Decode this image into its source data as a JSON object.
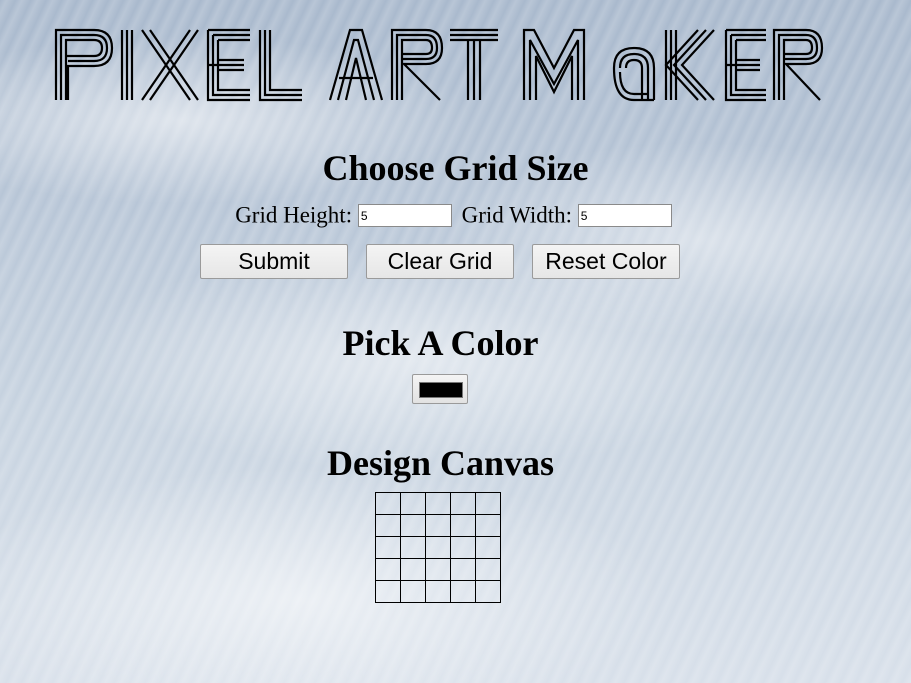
{
  "header": {
    "logo_text": "Pixel Art Maker"
  },
  "grid_size": {
    "title": "Choose Grid Size",
    "height_label": "Grid Height:",
    "height_value": "5",
    "width_label": "Grid Width:",
    "width_value": "5"
  },
  "buttons": {
    "submit_label": "Submit",
    "clear_label": "Clear Grid",
    "reset_label": "Reset Color"
  },
  "color": {
    "title": "Pick A Color",
    "value": "#000000"
  },
  "canvas": {
    "title": "Design Canvas",
    "rows": 5,
    "cols": 5,
    "cell_color": "#ffffff00"
  },
  "colors": {
    "logo": "#000000",
    "text": "#000000"
  }
}
